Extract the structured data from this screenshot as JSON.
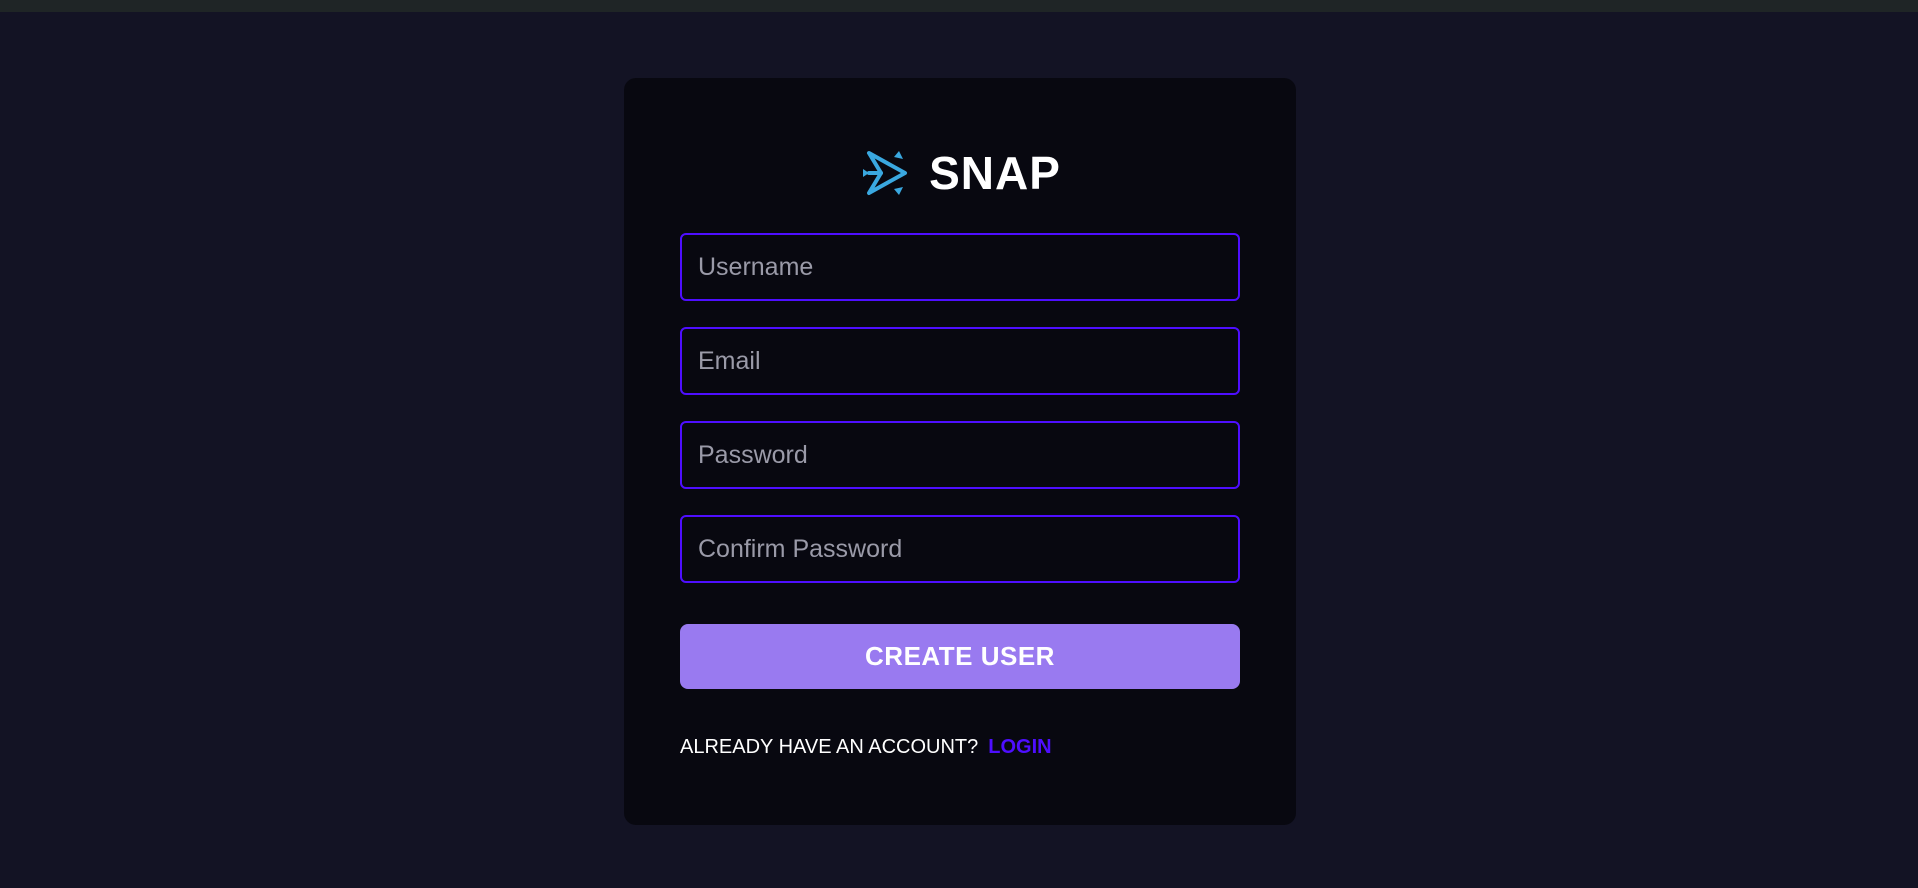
{
  "brand": {
    "name": "SNAP",
    "logo_icon": "snap-arrow-logo-icon",
    "logo_color": "#3aa8e0"
  },
  "form": {
    "username": {
      "placeholder": "Username",
      "value": ""
    },
    "email": {
      "placeholder": "Email",
      "value": ""
    },
    "password": {
      "placeholder": "Password",
      "value": ""
    },
    "confirm_password": {
      "placeholder": "Confirm Password",
      "value": ""
    },
    "submit_label": "CREATE USER"
  },
  "footer": {
    "prompt": "ALREADY HAVE AN ACCOUNT?",
    "login_label": "LOGIN"
  },
  "colors": {
    "page_background": "#131324",
    "card_background": "#080810",
    "input_border": "#4e0eff",
    "button_background": "#997af0",
    "link": "#4e0eff"
  }
}
